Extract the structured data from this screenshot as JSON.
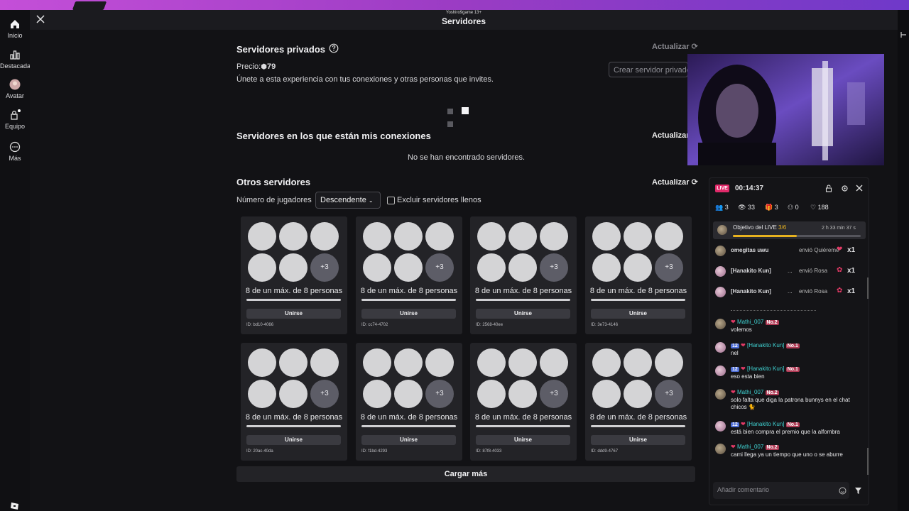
{
  "stream_overlay": {
    "streamer_tag": "Yoshiro9game 13+"
  },
  "window": {
    "title": "Servidores"
  },
  "sidebar": {
    "items": [
      {
        "label": "Inicio",
        "icon": "home-icon"
      },
      {
        "label": "Destacadas",
        "icon": "chart-icon"
      },
      {
        "label": "Avatar",
        "icon": "avatar-icon"
      },
      {
        "label": "Equipo",
        "icon": "team-icon"
      },
      {
        "label": "Más",
        "icon": "more-icon"
      }
    ]
  },
  "private_servers": {
    "title": "Servidores privados",
    "refresh_label": "Actualizar",
    "price_label": "Precio:",
    "price_value": "79",
    "description": "Únete a esta experiencia con tus conexiones y otras personas que invites.",
    "create_button": "Crear servidor privado"
  },
  "friends_servers": {
    "title": "Servidores en los que están mis conexiones",
    "refresh_label": "Actualizar",
    "empty_message": "No se han encontrado servidores."
  },
  "other_servers": {
    "title": "Otros servidores",
    "refresh_label": "Actualizar",
    "players_label": "Número de jugadores",
    "sort_value": "Descendente",
    "exclude_full_label": "Excluir servidores llenos",
    "join_label": "Unirse",
    "capacity_text": "8 de un máx. de 8 personas",
    "extra_players": "+3",
    "fill_fraction": 1.0,
    "servers": [
      {
        "id": "ID: bd10-4066"
      },
      {
        "id": "ID: cc74-4702"
      },
      {
        "id": "ID: 2568-40ee"
      },
      {
        "id": "ID: 3e73-4146"
      },
      {
        "id": "ID: 20ac-40da"
      },
      {
        "id": "ID: f1bd-4293"
      },
      {
        "id": "ID: 87f8-4033"
      },
      {
        "id": "ID: ddd9-4767"
      }
    ],
    "load_more": "Cargar más"
  },
  "live": {
    "badge": "LIVE",
    "timer": "00:14:37",
    "stats": {
      "users": "3",
      "viewers": "33",
      "gifts": "3",
      "follows": "0",
      "likes": "188"
    },
    "goal": {
      "label": "Objetivo del LIVE",
      "progress_text": "3/6",
      "remaining": "2 h 33 min 37 s",
      "progress_fraction": 0.5
    },
    "gifts": [
      {
        "user": "omegitas uwu",
        "action": "envió Quiéreme",
        "count": "x1"
      },
      {
        "user": "[Hanakito Kun]",
        "suffix": "...",
        "action": "envió Rosa",
        "count": "x1"
      },
      {
        "user": "[Hanakito Kun]",
        "suffix": "...",
        "action": "envió Rosa",
        "count": "x1"
      }
    ],
    "comments": [
      {
        "user": "Mathi_007",
        "rank": "No.2",
        "text": "volemos"
      },
      {
        "user": "[Hanakito Kun]",
        "level": "12",
        "rank": "No.1",
        "text": "nel"
      },
      {
        "user": "[Hanakito Kun]",
        "level": "12",
        "rank": "No.1",
        "text": "eso esta bien"
      },
      {
        "user": "Mathi_007",
        "rank": "No.2",
        "text": "solo falta que diga la patrona bunnys en el chat chicos 🐈"
      },
      {
        "user": "[Hanakito Kun]",
        "level": "12",
        "rank": "No.1",
        "text": "está bien compra el premio que la alfombra"
      },
      {
        "user": "Mathi_007",
        "rank": "No.2",
        "text": "cami llega ya un tiempo que uno o se aburre"
      }
    ],
    "comment_placeholder": "Añadir comentario"
  }
}
